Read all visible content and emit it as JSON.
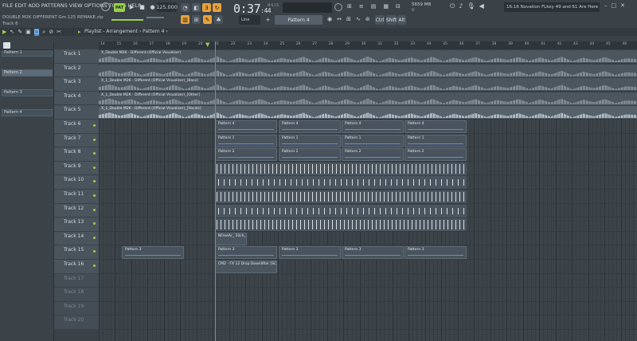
{
  "menu": [
    "FILE",
    "EDIT",
    "ADD",
    "PATTERNS",
    "VIEW",
    "OPTIONS",
    "TOOLS",
    "HELP"
  ],
  "project": {
    "filename": "DOUBLE M2K DIFFERENT Gm 125 REMAKE.zip",
    "hint": "Track 6"
  },
  "transport": {
    "pat_label": "PAT",
    "tempo": "125.000",
    "time_main": "0:37",
    "time_small": ":44",
    "time_unit": "M:S:CS"
  },
  "stats": {
    "memory": "5659 MB",
    "cpu": "0"
  },
  "hintbar": "16:16 Novation FLkey 49 and 61 Are Here",
  "toolbar2": {
    "snap": "Line",
    "pattern": "Pattern 4",
    "ctrl": "Ctrl",
    "shift": "Shift",
    "alt": "Alt"
  },
  "playlist": {
    "breadcrumb": "Playlist - Arrangement › Pattern 4 ›"
  },
  "patterns": [
    "Pattern 1",
    "Pattern 2",
    "Pattern 3",
    "Pattern 4"
  ],
  "tracks": [
    "Track 1",
    "Track 2",
    "Track 3",
    "Track 4",
    "Track 5",
    "Track 6",
    "Track 7",
    "Track 8",
    "Track 9",
    "Track 10",
    "Track 11",
    "Track 12",
    "Track 13",
    "Track 14",
    "Track 15",
    "Track 16",
    "Track 17",
    "Track 18",
    "Track 19",
    "Track 20"
  ],
  "ruler": [
    "14",
    "15",
    "16",
    "17",
    "18",
    "19",
    "20",
    "21",
    "22",
    "23",
    "24",
    "25",
    "26",
    "27",
    "28",
    "29",
    "30",
    "31",
    "32",
    "33",
    "34",
    "35",
    "36",
    "37",
    "38",
    "39",
    "40",
    "41",
    "42",
    "43",
    "44",
    "45",
    "46"
  ],
  "clips": {
    "t1": "X_Double M2K - Different (Official Visualizer)",
    "t3": "X_1_Double M2K - Different (Official Visualizer)_[Bass]",
    "t4": "X_1_Double M2K - Different (Official Visualizer)_[Drums]",
    "t4b": "X_1_Double M2K - Different (Official Visualizer)_[Other]",
    "t5": "X_1_Double M2K - Different (Official Visualizer)_[Vocals]",
    "p4": "Pattern 4",
    "p1": "Pattern 1",
    "p2": "Pattern 2",
    "p3": "Pattern 3",
    "t14": "NFreeAr_ 10ch_01",
    "t16": "CM2 - FX 12 Drop Downlifter [SC]"
  },
  "colors": {
    "accent": "#9ad04c",
    "pattern_note": "#6f82d8"
  }
}
